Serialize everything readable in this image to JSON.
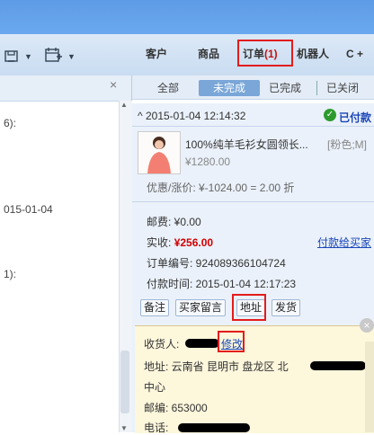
{
  "toolbar": {
    "icons": [
      "save-icon",
      "calendar-add-icon"
    ],
    "tabs": {
      "customers": "客户",
      "products": "商品",
      "orders": "订单",
      "orders_count": "(1)",
      "robot": "机器人",
      "more": "C +"
    }
  },
  "left": {
    "close": "×",
    "lines": [
      "6):",
      "015-01-04",
      "1):"
    ]
  },
  "filters": [
    "全部",
    "未完成",
    "已完成",
    "已关闭"
  ],
  "order": {
    "datetime": "^ 2015-01-04 12:14:32",
    "status": "已付款",
    "product_title": "100%纯羊毛衫女圆领长...",
    "product_variant": "[粉色;M]",
    "product_price": "¥1280.00",
    "discount_label": "优惠/涨价: ¥-1024.00 = 2.00 折",
    "shipping_fee": "邮费: ¥0.00",
    "paid_label": "实收:",
    "paid_value": "¥256.00",
    "pay_to_seller": "付款给买家",
    "order_no": "订单编号: 924089366104724",
    "pay_time": "付款时间: 2015-01-04 12:17:23"
  },
  "actions": {
    "note": "备注",
    "buyer_msg": "买家留言",
    "address": "地址",
    "shipping": "发货"
  },
  "address": {
    "receiver_label": "收货人:",
    "edit": "修改",
    "addr_label": "地址: 云南省 昆明市 盘龙区 北",
    "addr_line2": "中心",
    "zip": "邮编: 653000",
    "phone": "电话:"
  },
  "colors": {
    "accent_red": "#e31c1c",
    "price_red": "#d10000",
    "link_blue": "#1a46b8",
    "status_green": "#2e9a2e"
  }
}
